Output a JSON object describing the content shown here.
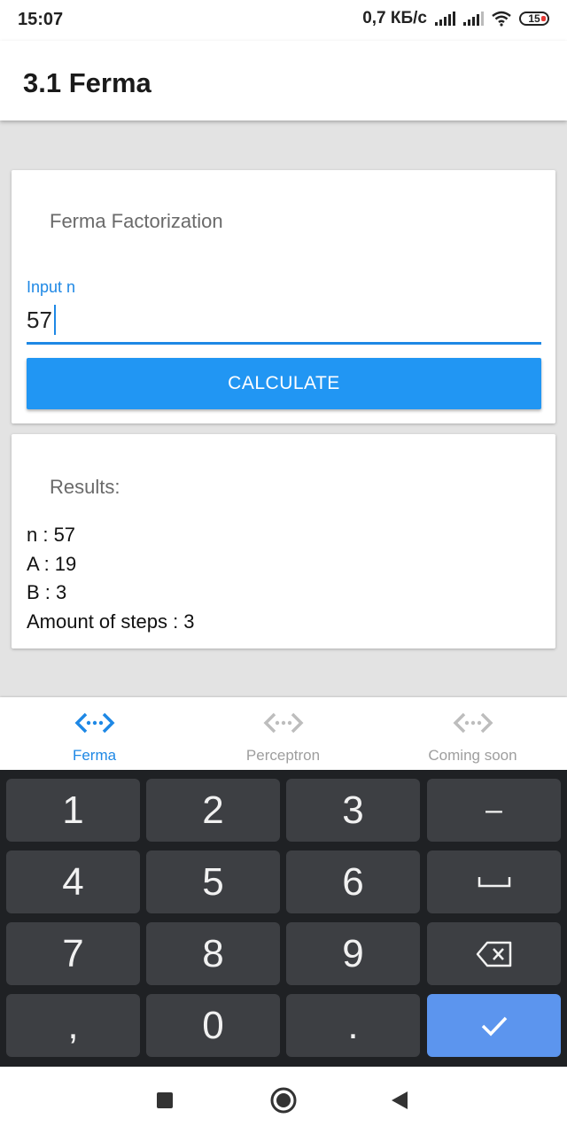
{
  "status_bar": {
    "time": "15:07",
    "network_speed": "0,7 КБ/с",
    "battery": "15",
    "icons": [
      "signal-icon",
      "signal-icon",
      "wifi-icon",
      "battery-icon"
    ]
  },
  "toolbar": {
    "title": "3.1 Ferma"
  },
  "factorization_card": {
    "title": "Ferma Factorization",
    "input_label": "Input n",
    "input_value": "57",
    "button_label": "CALCULATE"
  },
  "results_card": {
    "title": "Results:",
    "lines": [
      "n : 57",
      "A : 19",
      "B : 3",
      "Amount of steps : 3"
    ]
  },
  "bottom_nav": {
    "items": [
      {
        "label": "Ferma",
        "icon": "code-arrows-icon",
        "active": true
      },
      {
        "label": "Perceptron",
        "icon": "code-arrows-icon",
        "active": false
      },
      {
        "label": "Coming soon",
        "icon": "code-arrows-icon",
        "active": false
      }
    ]
  },
  "keyboard": {
    "keys": [
      [
        "1",
        "2",
        "3",
        "–"
      ],
      [
        "4",
        "5",
        "6",
        "space-icon"
      ],
      [
        "7",
        "8",
        "9",
        "backspace-icon"
      ],
      [
        ",",
        "0",
        ".",
        "done-check-icon"
      ]
    ]
  },
  "system_nav": {
    "icons": [
      "recents-square-icon",
      "home-circle-icon",
      "back-triangle-icon"
    ]
  },
  "colors": {
    "accent": "#2196f3",
    "active_nav": "#1e88e5",
    "inactive_nav": "#9e9e9e",
    "keyboard_bg": "#1f2124",
    "key_bg": "#3d3f43",
    "done_key": "#5c95ee"
  }
}
